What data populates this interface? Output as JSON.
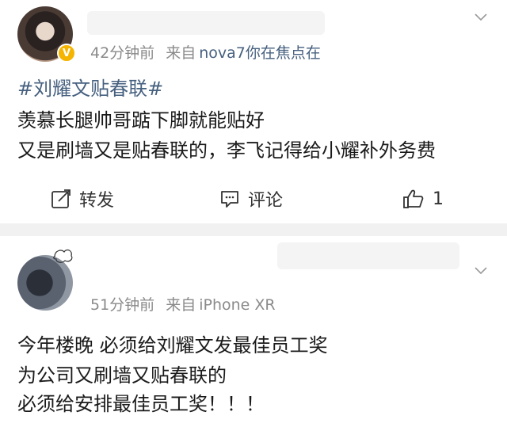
{
  "post1": {
    "time": "42分钟前",
    "via_prefix": "来自",
    "client": "nova7你在焦点在",
    "verified_badge": "V",
    "hashtag": "#刘耀文贴春联#",
    "lines": [
      "羡慕长腿帅哥踮下脚就能贴好",
      "又是刷墙又是贴春联的，李飞记得给小耀补外务费"
    ],
    "actions": {
      "repost_label": "转发",
      "comment_label": "评论",
      "like_count": "1"
    }
  },
  "post2": {
    "time": "51分钟前",
    "via_prefix": "来自",
    "client": "iPhone XR",
    "lines": [
      "今年楼晚 必须给刘耀文发最佳员工奖",
      "为公司又刷墙又贴春联的",
      " 必须给安排最佳员工奖！！！"
    ]
  },
  "icons": {
    "repost": "share-icon",
    "comment": "comment-icon",
    "like": "thumbs-up-icon",
    "more": "chevron-down-icon"
  },
  "colors": {
    "link_blue": "#46607f",
    "meta_gray": "#8a8a8a",
    "badge_gold": "#f5b400",
    "separator": "#f1f1f1"
  }
}
